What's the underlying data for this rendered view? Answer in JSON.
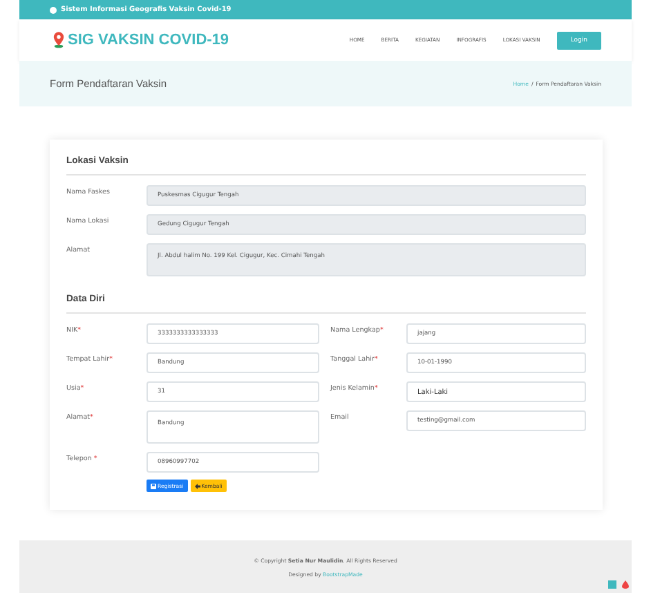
{
  "topbar": {
    "text": "Sistem Informasi Geografis Vaksin Covid-19"
  },
  "header": {
    "brand": "SIG VAKSIN COVID-19",
    "nav": [
      "HOME",
      "BERITA",
      "KEGIATAN",
      "INFOGRAFIS",
      "LOKASI VAKSIN"
    ],
    "login": "Login"
  },
  "page_title": {
    "title": "Form Pendaftaran Vaksin",
    "breadcrumb": [
      {
        "label": "Home",
        "kind": "link"
      },
      {
        "label": "/",
        "kind": "sep"
      },
      {
        "label": "Form Pendaftaran Vaksin",
        "kind": "current"
      }
    ]
  },
  "lokasi": {
    "heading": "Lokasi Vaksin",
    "fields": [
      {
        "label": "Nama Faskes",
        "value": "Puskesmas Cigugur Tengah",
        "kind": "input"
      },
      {
        "label": "Nama Lokasi",
        "value": "Gedung Cigugur Tengah",
        "kind": "input"
      },
      {
        "label": "Alamat",
        "value": "Jl. Abdul halim No. 199 Kel. Cigugur, Kec. Cimahi Tengah",
        "kind": "textarea"
      }
    ]
  },
  "data_diri": {
    "heading": "Data Diri",
    "fields": [
      {
        "label": "NIK",
        "mark": "*",
        "value": "3333333333333333",
        "kind": "input"
      },
      {
        "label": "Nama Lengkap",
        "mark": "*",
        "value": "jajang",
        "kind": "input"
      },
      {
        "label": "Tempat Lahir",
        "mark": "*",
        "value": "Bandung",
        "kind": "input"
      },
      {
        "label": "Tanggal Lahir",
        "mark": "*",
        "value": "10-01-1990",
        "kind": "input"
      },
      {
        "label": "Usia",
        "mark": "*",
        "value": "31",
        "kind": "input"
      },
      {
        "label": "Jenis Kelamin",
        "mark": "*",
        "value": "Laki-Laki",
        "kind": "select"
      },
      {
        "label": "Alamat",
        "mark": "*",
        "value": "Bandung",
        "kind": "textarea"
      },
      {
        "label": "Email",
        "value": "testing@gmail.com",
        "kind": "input"
      },
      {
        "label": "Telepon ",
        "mark": "*",
        "value": "08960997702",
        "kind": "input"
      }
    ],
    "buttons": [
      {
        "label": "Registrasi",
        "kind": "primary"
      },
      {
        "label": "Kembali",
        "kind": "warning"
      }
    ]
  },
  "footer": {
    "copyright": "© Copyright **Setia Nur Maulidin**. All Rights Reserved",
    "designed_by": "Designed by ",
    "designer": "BootstrapMade"
  }
}
